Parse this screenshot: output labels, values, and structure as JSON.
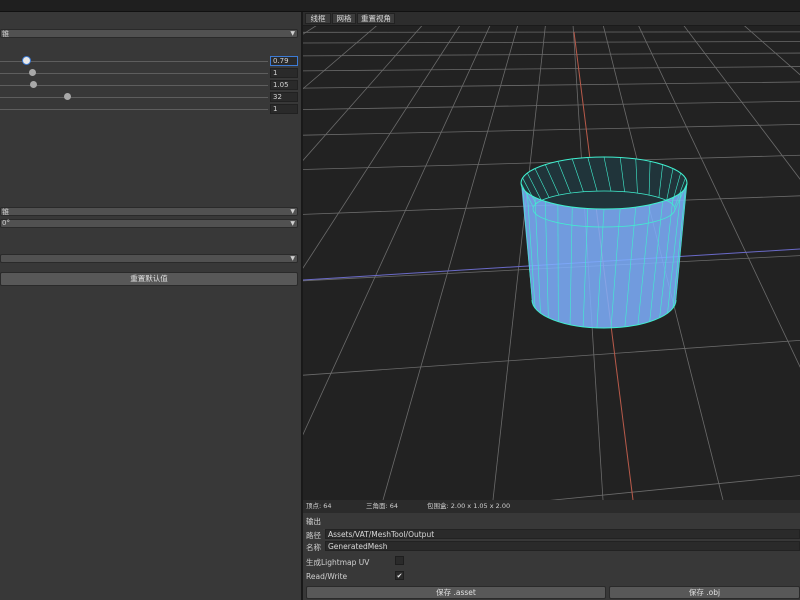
{
  "panel": {
    "dropdown1": {
      "value": "锥"
    },
    "sliders": [
      {
        "value": "0.79",
        "fraction": 0.05,
        "focused": true
      },
      {
        "value": "1",
        "fraction": 0.07
      },
      {
        "value": "1.05",
        "fraction": 0.075
      },
      {
        "value": "32",
        "fraction": 0.2
      },
      {
        "value": "1",
        "fraction": 0.0
      }
    ],
    "dropdown2": {
      "value": "锥"
    },
    "dropdown3": {
      "value": "0°"
    },
    "dropdown4": {
      "value": ""
    },
    "reset_label": "重置默认值"
  },
  "viewport": {
    "tabs": [
      "线框",
      "网格",
      "重置视角"
    ],
    "colors": {
      "background": "#222222",
      "grid": "#6b6b6b",
      "axis_red": "#b85a4a",
      "axis_blue": "#6a6ac8",
      "mesh_fill": "#7fb0ff",
      "mesh_wire": "#40f0d0"
    }
  },
  "status": {
    "vertices": "顶点: 64",
    "triangles": "三角面: 64",
    "bounds": "包围盒: 2.00 x 1.05 x 2.00"
  },
  "output": {
    "title": "输出",
    "path_label": "路径",
    "path_value": "Assets/VAT/MeshTool/Output",
    "name_label": "名称",
    "name_value": "GeneratedMesh",
    "lightmap_label": "生成Lightmap UV",
    "lightmap_checked": false,
    "readwrite_label": "Read/Write",
    "readwrite_checked": true,
    "save_asset_label": "保存 .asset",
    "save_obj_label": "保存 .obj"
  }
}
